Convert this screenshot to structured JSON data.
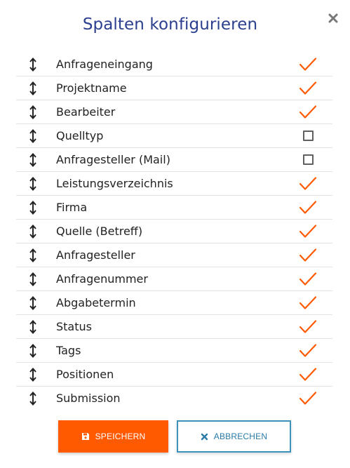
{
  "dialog": {
    "title": "Spalten konfigurieren",
    "close_icon": "close-icon"
  },
  "columns": [
    {
      "label": "Anfrageneingang",
      "checked": true
    },
    {
      "label": "Projektname",
      "checked": true
    },
    {
      "label": "Bearbeiter",
      "checked": true
    },
    {
      "label": "Quelltyp",
      "checked": false
    },
    {
      "label": "Anfragesteller (Mail)",
      "checked": false
    },
    {
      "label": "Leistungsverzeichnis",
      "checked": true
    },
    {
      "label": "Firma",
      "checked": true
    },
    {
      "label": "Quelle (Betreff)",
      "checked": true
    },
    {
      "label": "Anfragesteller",
      "checked": true
    },
    {
      "label": "Anfragenummer",
      "checked": true
    },
    {
      "label": "Abgabetermin",
      "checked": true
    },
    {
      "label": "Status",
      "checked": true
    },
    {
      "label": "Tags",
      "checked": true
    },
    {
      "label": "Positionen",
      "checked": true
    },
    {
      "label": "Submission",
      "checked": true
    }
  ],
  "buttons": {
    "save_label": "SPEICHERN",
    "cancel_label": "ABBRECHEN"
  },
  "colors": {
    "title": "#2b3f8f",
    "checkmark": "#ff5a00",
    "save_bg": "#ff5a00",
    "cancel_border": "#3d92bc"
  }
}
